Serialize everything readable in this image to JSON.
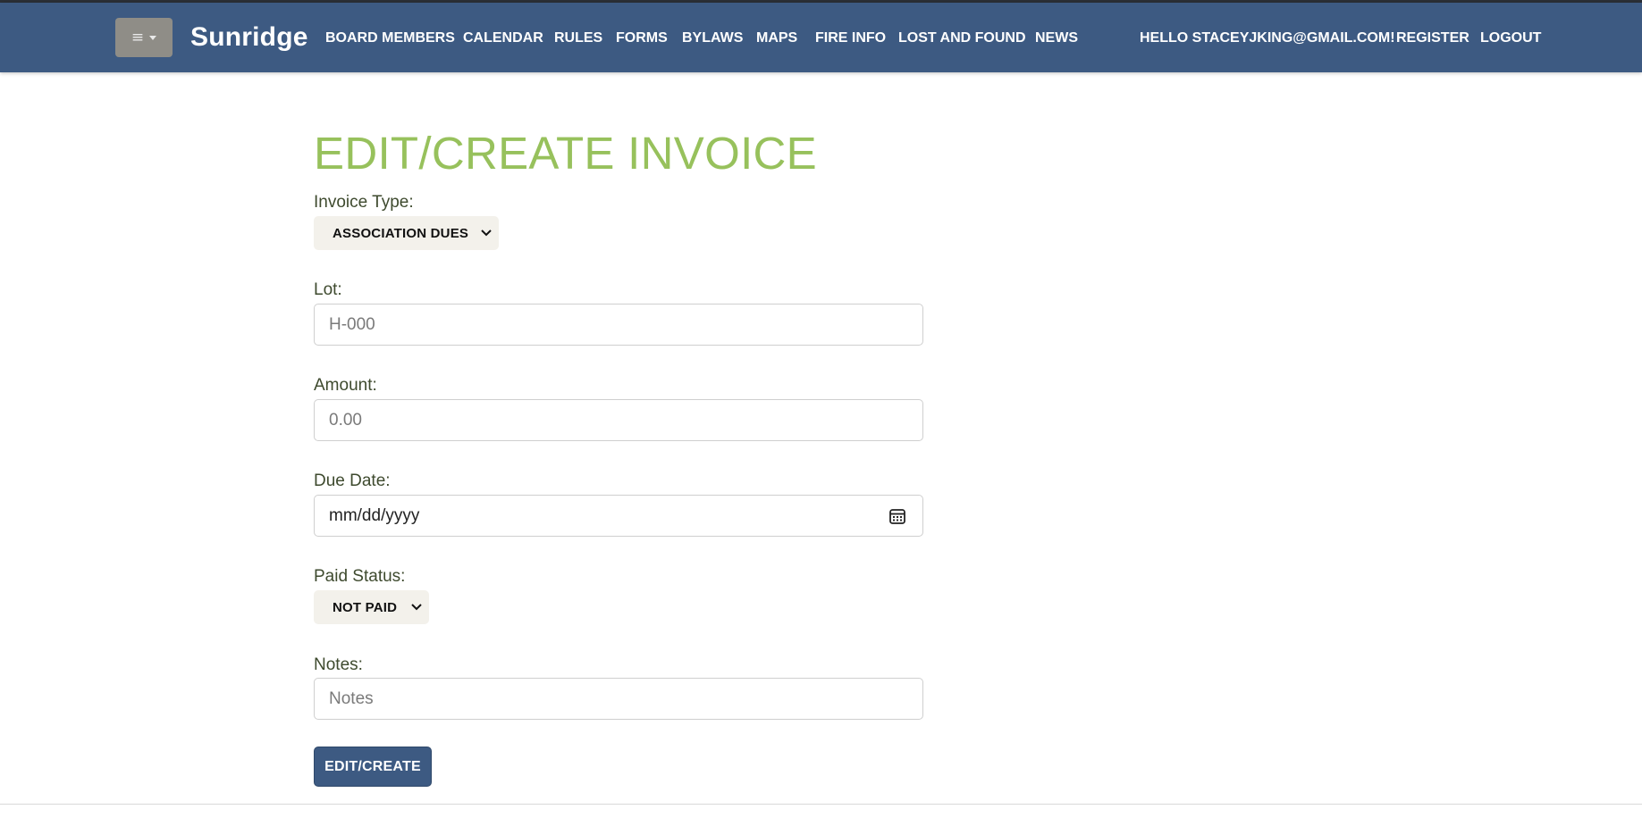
{
  "nav": {
    "menu_icon": "hamburger-icon",
    "brand": "Sunridge",
    "links": [
      "BOARD MEMBERS",
      "CALENDAR",
      "RULES",
      "FORMS",
      "BYLAWS",
      "MAPS",
      "FIRE INFO",
      "LOST AND FOUND",
      "NEWS"
    ],
    "greeting": "HELLO STACEYJKING@GMAIL.COM!",
    "register": "REGISTER",
    "logout": "LOGOUT"
  },
  "form": {
    "title": "EDIT/CREATE INVOICE",
    "invoice_type_label": "Invoice Type:",
    "invoice_type_value": "ASSOCIATION DUES",
    "lot_label": "Lot:",
    "lot_placeholder": "H-000",
    "amount_label": "Amount:",
    "amount_placeholder": "0.00",
    "due_date_label": "Due Date:",
    "due_date_placeholder": "mm/dd/yyyy",
    "paid_status_label": "Paid Status:",
    "paid_status_value": "NOT PAID",
    "notes_label": "Notes:",
    "notes_placeholder": "Notes",
    "submit": "EDIT/CREATE"
  },
  "colors": {
    "navbar": "#3d5a82",
    "title": "#97c15c",
    "button": "#3d5a82"
  }
}
